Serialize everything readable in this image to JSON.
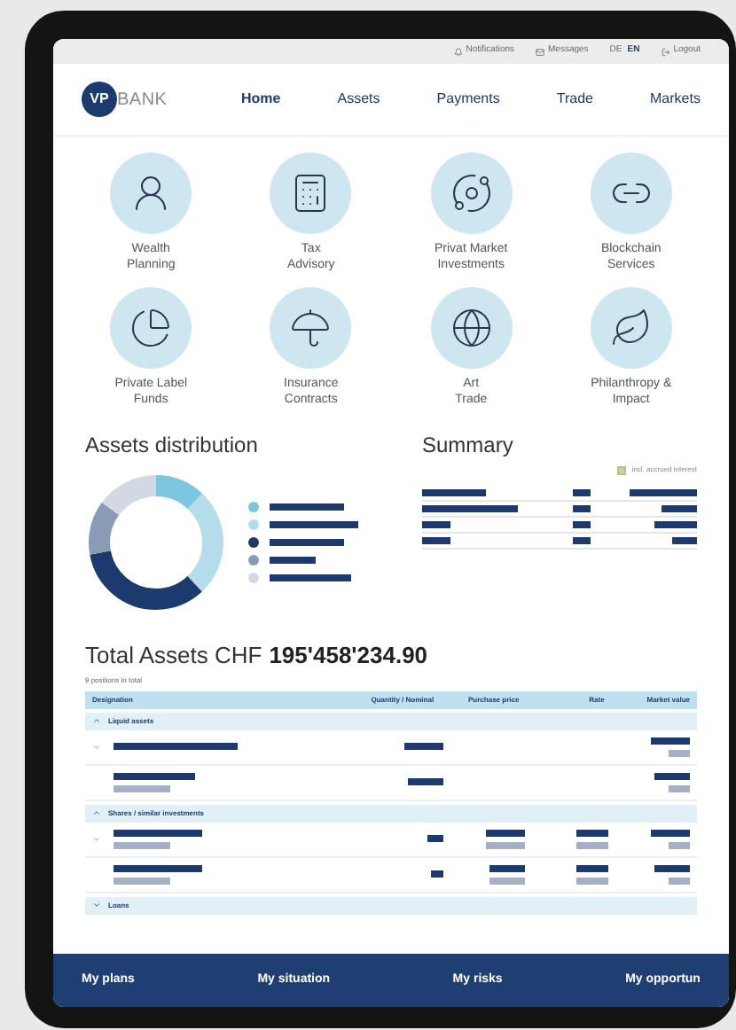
{
  "utility_bar": {
    "notifications": "Notifications",
    "messages": "Messages",
    "languages": [
      {
        "label": "DE",
        "selected": false
      },
      {
        "label": "EN",
        "selected": true
      }
    ],
    "logout": "Logout"
  },
  "logo": {
    "letters": "VP",
    "word": "BANK"
  },
  "nav": [
    {
      "label": "Home",
      "selected": true
    },
    {
      "label": "Assets",
      "selected": false
    },
    {
      "label": "Payments",
      "selected": false
    },
    {
      "label": "Trade",
      "selected": false
    },
    {
      "label": "Markets",
      "selected": false
    }
  ],
  "services": [
    {
      "kind": "wealth",
      "lines": [
        "Wealth",
        "Planning"
      ]
    },
    {
      "kind": "tax",
      "lines": [
        "Tax",
        "Advisory"
      ]
    },
    {
      "kind": "private",
      "lines": [
        "Privat Market",
        "Investments"
      ]
    },
    {
      "kind": "chain",
      "lines": [
        "Blockchain",
        "Services"
      ]
    },
    {
      "kind": "funds",
      "lines": [
        "Private Label",
        "Funds"
      ]
    },
    {
      "kind": "insurance",
      "lines": [
        "Insurance",
        "Contracts"
      ]
    },
    {
      "kind": "art",
      "lines": [
        "Art",
        "Trade"
      ]
    },
    {
      "kind": "philanthropy",
      "lines": [
        "Philanthropy &",
        "Impact"
      ]
    }
  ],
  "distribution": {
    "title": "Assets distribution",
    "legend": [
      {
        "color": "#7cc6e0"
      },
      {
        "color": "#b5dcea"
      },
      {
        "color": "#1c3a6e"
      },
      {
        "color": "#8a9bb5"
      },
      {
        "color": "#d3d9e4"
      }
    ]
  },
  "summary": {
    "title": "Summary",
    "option": {
      "label": "incl. accrued interest",
      "checked": true
    }
  },
  "total": {
    "label": "Total Assets CHF",
    "amount": "195'458'234.90",
    "positions": "9 positions in total",
    "columns": [
      "Designation",
      "Quantity / Nominal",
      "Purchase price",
      "Rate",
      "Market value"
    ],
    "groups": [
      {
        "label": "Liquid assets",
        "expanded": true
      },
      {
        "label": "Shares / similar investments",
        "expanded": true
      },
      {
        "label": "Loans",
        "expanded": false
      }
    ]
  },
  "bottom_nav": [
    "My plans",
    "My situation",
    "My risks",
    "My opportun"
  ]
}
